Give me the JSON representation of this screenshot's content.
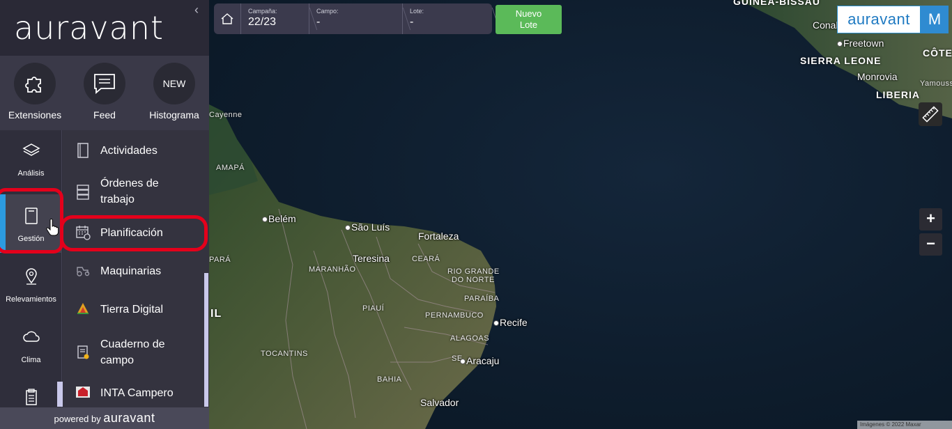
{
  "app": {
    "logo": "auravant",
    "powered_prefix": "powered by",
    "powered_brand": "auravant"
  },
  "shortcuts": [
    {
      "label": "Extensiones",
      "icon": "puzzle-icon"
    },
    {
      "label": "Feed",
      "icon": "chat-icon"
    },
    {
      "label": "Histograma",
      "badge": "NEW"
    }
  ],
  "rail": [
    {
      "label": "Análisis",
      "icon": "layers-icon"
    },
    {
      "label": "Gestión",
      "icon": "notebook-icon",
      "active": true
    },
    {
      "label": "Relevamientos",
      "icon": "map-pin-icon"
    },
    {
      "label": "Clima",
      "icon": "cloud-icon"
    }
  ],
  "submenu": [
    {
      "label": "Actividades",
      "icon": "notebook-icon"
    },
    {
      "label_l1": "Órdenes de",
      "label_l2": "trabajo",
      "icon": "server-icon"
    },
    {
      "label": "Planificación",
      "icon": "calendar-icon"
    },
    {
      "label": "Maquinarias",
      "icon": "tractor-icon"
    },
    {
      "label": "Tierra Digital",
      "icon": "tierra-digital-icon"
    },
    {
      "label_l1": "Cuaderno de",
      "label_l2": "campo",
      "icon": "field-notebook-icon"
    },
    {
      "label": "INTA Campero",
      "icon": "inta-icon"
    }
  ],
  "selector": {
    "campaign_label": "Campaña:",
    "campaign_value": "22/23",
    "field_label": "Campo:",
    "field_value": "-",
    "lot_label": "Lote:",
    "lot_value": "-"
  },
  "new_lot": {
    "line1": "Nuevo",
    "line2": "Lote"
  },
  "topright": {
    "brand": "auravant",
    "avatar": "M"
  },
  "zoom": {
    "in": "+",
    "out": "−"
  },
  "map": {
    "countries": [
      "GUINEA-BISSAU",
      "SIERRA LEONE",
      "LIBERIA",
      "CÔTE"
    ],
    "cities": [
      "Conakry",
      "Freetown",
      "Monrovia",
      "Yamoussou",
      "Cayenne",
      "Belém",
      "São Luís",
      "Fortaleza",
      "Teresina",
      "Recife",
      "Aracaju",
      "Salvador"
    ],
    "regions": [
      "AMAPÁ",
      "PARÁ",
      "MARANHÃO",
      "CEARÁ",
      "RIO GRANDE",
      "DO NORTE",
      "PARAÍBA",
      "PIAUÍ",
      "PERNAMBUCO",
      "ALAGOAS",
      "TOCANTINS",
      "SE",
      "BAHIA",
      "IL"
    ],
    "attribution": "Imágenes © 2022 Maxar"
  },
  "colors": {
    "accent_blue": "#2c9be0",
    "green": "#5bba59",
    "highlight": "#e4001b",
    "sidebar": "#2f2e3b"
  }
}
